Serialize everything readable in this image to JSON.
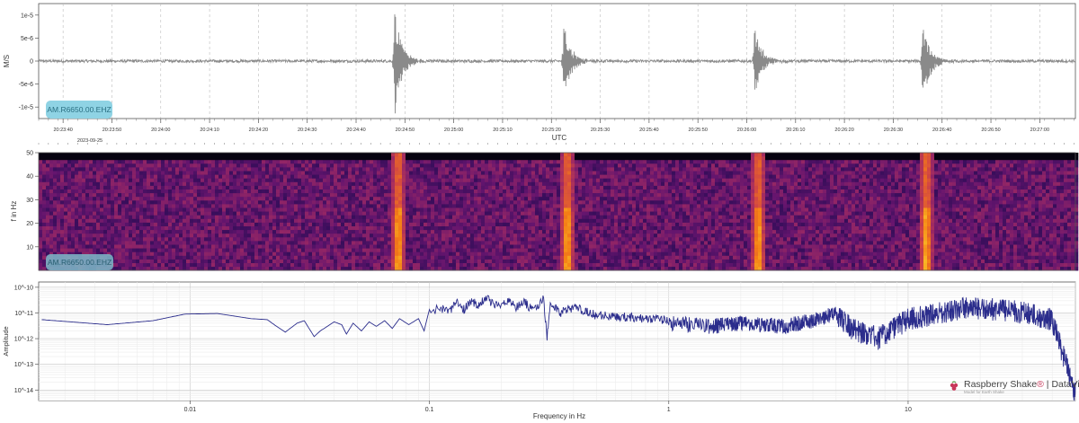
{
  "colors": {
    "trace": "#8a8a8a",
    "badge_fill": "#8fd3e4",
    "badge_text": "#2a6f82",
    "psd_line": "#2b2d8c",
    "grid": "#d8d8d8",
    "brand_accent": "#c8385a"
  },
  "chart_data": [
    {
      "type": "line",
      "name": "seismogram",
      "ylabel": "M/S",
      "xlabel": "UTC",
      "date_label": "2023-09-25",
      "station_label": "AM.R6650.00.EHZ",
      "y_ticks": [
        "1e-5",
        "5e-6",
        "0",
        "-5e-6",
        "-1e-5"
      ],
      "y_tick_values": [
        1e-05,
        5e-06,
        0,
        -5e-06,
        -1e-05
      ],
      "ylim": [
        -1.25e-05,
        1.25e-05
      ],
      "x_ticks": [
        "20:23:40",
        "20:23:50",
        "20:24:00",
        "20:24:10",
        "20:24:20",
        "20:24:30",
        "20:24:40",
        "20:24:50",
        "20:25:00",
        "20:25:10",
        "20:25:20",
        "20:25:30",
        "20:25:40",
        "20:25:50",
        "20:26:00",
        "20:26:10",
        "20:26:20",
        "20:26:30",
        "20:26:40",
        "20:26:50",
        "20:27:00",
        "20:27:10"
      ],
      "x_range_seconds": [
        -5.0,
        207.3
      ],
      "events": [
        {
          "time": "20:24:47.9",
          "peak_up": 1.15e-05,
          "peak_down": -1.28e-05
        },
        {
          "time": "20:25:22.5",
          "peak_up": 9e-06,
          "peak_down": -9.5e-06
        },
        {
          "time": "20:26:01.6",
          "peak_up": 8.5e-06,
          "peak_down": -8e-06
        },
        {
          "time": "20:26:36.0",
          "peak_up": 8.5e-06,
          "peak_down": -1.05e-05
        }
      ],
      "noise_level": 3e-07,
      "grid": true
    },
    {
      "type": "heatmap",
      "name": "spectrogram",
      "ylabel": "f in Hz",
      "station_label": "AM.R6650.00.EHZ",
      "y_ticks": [
        "10",
        "20",
        "30",
        "40",
        "50"
      ],
      "y_tick_values": [
        10,
        20,
        30,
        40,
        50
      ],
      "ylim": [
        0,
        50
      ],
      "colormap": "inferno",
      "events_time": [
        "20:24:47.9",
        "20:25:22.5",
        "20:26:01.6",
        "20:26:36.0"
      ]
    },
    {
      "type": "line",
      "name": "amplitude-spectrum",
      "xlabel": "Frequency in Hz",
      "ylabel": "Amplitude",
      "x_scale": "log",
      "y_scale": "log",
      "x_ticks": [
        "0.01",
        "0.1",
        "1",
        "10"
      ],
      "x_tick_values": [
        0.01,
        0.1,
        1,
        10
      ],
      "xlim": [
        0.00233,
        50
      ],
      "y_ticks": [
        "10^-10",
        "10^-11",
        "10^-12",
        "10^-13",
        "10^-14"
      ],
      "y_tick_values": [
        1e-10,
        1e-11,
        1e-12,
        1e-13,
        1e-14
      ],
      "ylim": [
        3.9e-15,
        1.6e-10
      ],
      "points": [
        [
          0.0024,
          5.5e-12
        ],
        [
          0.0045,
          3.5e-12
        ],
        [
          0.007,
          5e-12
        ],
        [
          0.0095,
          9e-12
        ],
        [
          0.013,
          9.5e-12
        ],
        [
          0.018,
          6e-12
        ],
        [
          0.021,
          5.5e-12
        ],
        [
          0.023,
          3e-12
        ],
        [
          0.025,
          1.8e-12
        ],
        [
          0.028,
          4e-12
        ],
        [
          0.03,
          5e-12
        ],
        [
          0.033,
          1.2e-12
        ],
        [
          0.035,
          2e-12
        ],
        [
          0.04,
          4.5e-12
        ],
        [
          0.043,
          3.5e-12
        ],
        [
          0.045,
          1.5e-12
        ],
        [
          0.048,
          4e-12
        ],
        [
          0.052,
          2e-12
        ],
        [
          0.056,
          4.5e-12
        ],
        [
          0.06,
          3e-12
        ],
        [
          0.065,
          5e-12
        ],
        [
          0.07,
          2.5e-12
        ],
        [
          0.075,
          6e-12
        ],
        [
          0.082,
          3.5e-12
        ],
        [
          0.09,
          6e-12
        ],
        [
          0.095,
          2e-12
        ],
        [
          0.1,
          1.4e-11
        ],
        [
          0.11,
          2.5e-11
        ],
        [
          0.12,
          1.5e-11
        ],
        [
          0.13,
          4e-11
        ],
        [
          0.14,
          2e-11
        ],
        [
          0.15,
          5e-11
        ],
        [
          0.16,
          2.5e-11
        ],
        [
          0.17,
          6e-11
        ],
        [
          0.19,
          3e-11
        ],
        [
          0.21,
          4.5e-11
        ],
        [
          0.23,
          2.5e-11
        ],
        [
          0.25,
          4e-11
        ],
        [
          0.27,
          1.8e-11
        ],
        [
          0.29,
          3.5e-11
        ],
        [
          0.3,
          6e-11
        ],
        [
          0.31,
          1.5e-12
        ],
        [
          0.32,
          4e-11
        ],
        [
          0.35,
          1.5e-11
        ],
        [
          0.4,
          2.5e-11
        ],
        [
          0.5,
          1.2e-11
        ],
        [
          0.7,
          1e-11
        ],
        [
          1.0,
          8e-12
        ],
        [
          1.5,
          6e-12
        ],
        [
          2.0,
          8e-12
        ],
        [
          3.0,
          6e-12
        ],
        [
          4.0,
          1e-11
        ],
        [
          5.0,
          2e-11
        ],
        [
          6.0,
          6e-12
        ],
        [
          7.5,
          3e-12
        ],
        [
          10,
          1.6e-11
        ],
        [
          13,
          2.5e-11
        ],
        [
          17,
          4.5e-11
        ],
        [
          22,
          4e-11
        ],
        [
          30,
          3e-11
        ],
        [
          40,
          1.5e-11
        ],
        [
          50,
          2e-14
        ]
      ],
      "grid": true
    }
  ],
  "logo": {
    "brand": "Raspberry Shake",
    "brand_reg": "®",
    "separator": " | ",
    "product": "DataView",
    "tagline": "Model for Earth Shake"
  }
}
